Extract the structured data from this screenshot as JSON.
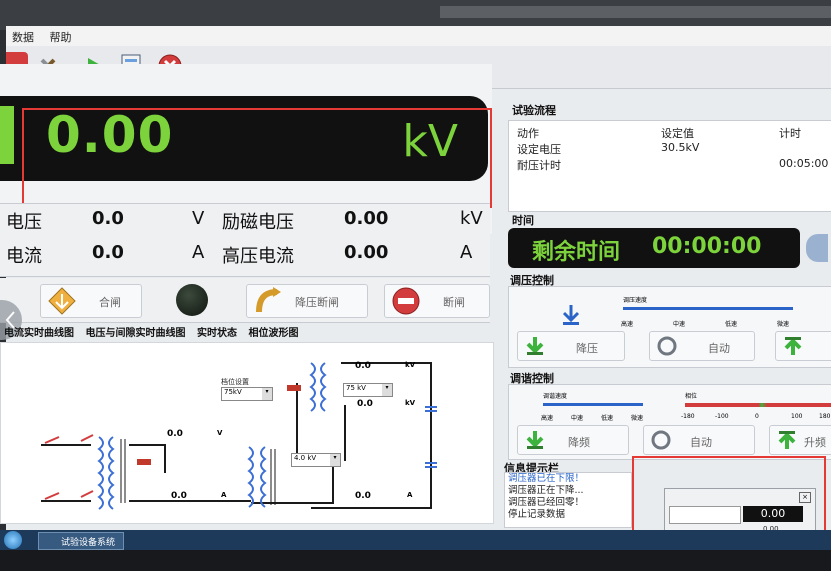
{
  "menubar": {
    "items": [
      "数据",
      "帮助"
    ]
  },
  "display": {
    "value": "0.00",
    "unit": "kV"
  },
  "measurements": {
    "row1": {
      "left_label": "电压",
      "left_value": "0.0",
      "left_unit": "V",
      "right_label": "励磁电压",
      "right_value": "0.00",
      "right_unit": "kV"
    },
    "row2": {
      "left_label": "电流",
      "left_value": "0.0",
      "left_unit": "A",
      "right_label": "高压电流",
      "right_value": "0.00",
      "right_unit": "A"
    }
  },
  "controls": {
    "close_label": "合闸",
    "lower_break_label": "降压断闸",
    "break_label": "断闸"
  },
  "tabs": [
    "电流实时曲线图",
    "电压与间隙实时曲线图",
    "实时状态",
    "相位波形图"
  ],
  "diagram": {
    "phase_setting_label": "档位设置",
    "phase_setting_value": "75kV",
    "select2_value": "75 kV",
    "select3_value": "4.0 kV",
    "values": [
      "0.0",
      "0.0",
      "0.0",
      "0.0",
      "0.0",
      "0.0"
    ],
    "units": {
      "kv": "kV",
      "v": "V",
      "a": "A"
    }
  },
  "right": {
    "flow_title": "试验流程",
    "flow_headers": [
      "动作",
      "设定值",
      "计时"
    ],
    "flow_rows": [
      {
        "action": "设定电压",
        "value": "30.5kV",
        "time": ""
      },
      {
        "action": "耐压计时",
        "value": "",
        "time": "00:05:00"
      }
    ],
    "time_title": "时间",
    "remaining_label": "剩余时间",
    "remaining_value": "00:00:00",
    "volt_ctrl_title": "调压控制",
    "volt_speed_label": "调压速度",
    "volt_speeds": [
      "高速",
      "中速",
      "低速",
      "微速"
    ],
    "volt_down_label": "降压",
    "volt_auto_label": "自动",
    "tune_ctrl_title": "调谐控制",
    "tune_speed_label": "调谐速度",
    "tune_speeds": [
      "高速",
      "中速",
      "低速",
      "微速"
    ],
    "phase_label": "相位",
    "phase_ticks": [
      "-180",
      "-100",
      "0",
      "100",
      "180"
    ],
    "tune_down_label": "降频",
    "tune_auto_label": "自动",
    "tune_up_label": "升频",
    "info_title": "信息提示栏",
    "info_lines": [
      "调压器已在下限！",
      "调压器正在下降...",
      "调压器已经回零！",
      "停止记录数据"
    ],
    "dialog_value": "0.00",
    "dialog_sub": "0.00"
  },
  "taskbar": {
    "app_label": "试验设备系统"
  },
  "colors": {
    "display_green": "#7cd33b",
    "annotation_red": "#e53935"
  }
}
